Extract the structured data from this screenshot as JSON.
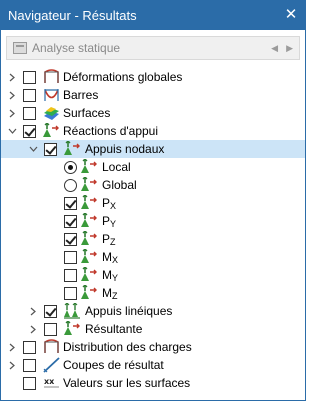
{
  "window": {
    "title": "Navigateur - Résultats",
    "close_glyph": "✕"
  },
  "combo": {
    "value": "Analyse statique",
    "prev_glyph": "◀",
    "next_glyph": "▶"
  },
  "tree": {
    "deformations": "Déformations globales",
    "barres": "Barres",
    "surfaces": "Surfaces",
    "reactions": "Réactions d'appui",
    "appuis_nodaux": "Appuis nodaux",
    "local": "Local",
    "global": "Global",
    "px": {
      "base": "P",
      "sub": "X"
    },
    "py": {
      "base": "P",
      "sub": "Y"
    },
    "pz": {
      "base": "P",
      "sub": "Z"
    },
    "mx": {
      "base": "M",
      "sub": "X"
    },
    "my": {
      "base": "M",
      "sub": "Y"
    },
    "mz": {
      "base": "M",
      "sub": "Z"
    },
    "appuis_lineiques": "Appuis linéiques",
    "resultante": "Résultante",
    "distribution": "Distribution des charges",
    "coupes": "Coupes de résultat",
    "valeurs": "Valeurs sur les surfaces"
  },
  "colors": {
    "title_bar": "#2b6ca8",
    "selection": "#cce4f7",
    "support_green": "#3a9a3a",
    "arrow_red": "#c0392b"
  }
}
